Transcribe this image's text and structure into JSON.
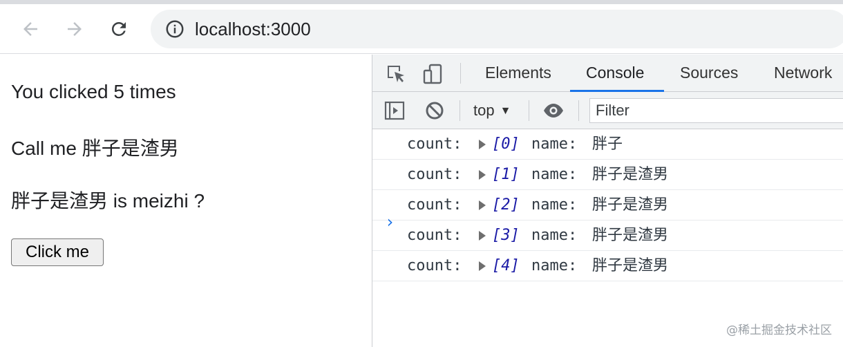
{
  "browser": {
    "url": "localhost:3000"
  },
  "page": {
    "count_text": "You clicked 5 times",
    "call_text": "Call me 胖子是渣男",
    "question_text": "胖子是渣男 is meizhi ?",
    "button_label": "Click me"
  },
  "devtools": {
    "tabs": [
      {
        "label": "Elements"
      },
      {
        "label": "Console"
      },
      {
        "label": "Sources"
      },
      {
        "label": "Network"
      }
    ],
    "active_tab": "Console",
    "context": "top",
    "filter_placeholder": "Filter",
    "console_rows": [
      {
        "label": "count:",
        "index": "[0]",
        "key": "name:",
        "value": "胖子"
      },
      {
        "label": "count:",
        "index": "[1]",
        "key": "name:",
        "value": "胖子是渣男"
      },
      {
        "label": "count:",
        "index": "[2]",
        "key": "name:",
        "value": "胖子是渣男"
      },
      {
        "label": "count:",
        "index": "[3]",
        "key": "name:",
        "value": "胖子是渣男"
      },
      {
        "label": "count:",
        "index": "[4]",
        "key": "name:",
        "value": "胖子是渣男"
      }
    ],
    "prompt_symbol": "›",
    "accent_color": "#1a73e8"
  },
  "watermark": "@稀土掘金技术社区",
  "icons": [
    "back-arrow-icon",
    "forward-arrow-icon",
    "reload-icon",
    "info-icon",
    "inspect-element-icon",
    "device-toolbar-icon",
    "sidebar-toggle-icon",
    "clear-console-icon",
    "eye-icon"
  ]
}
